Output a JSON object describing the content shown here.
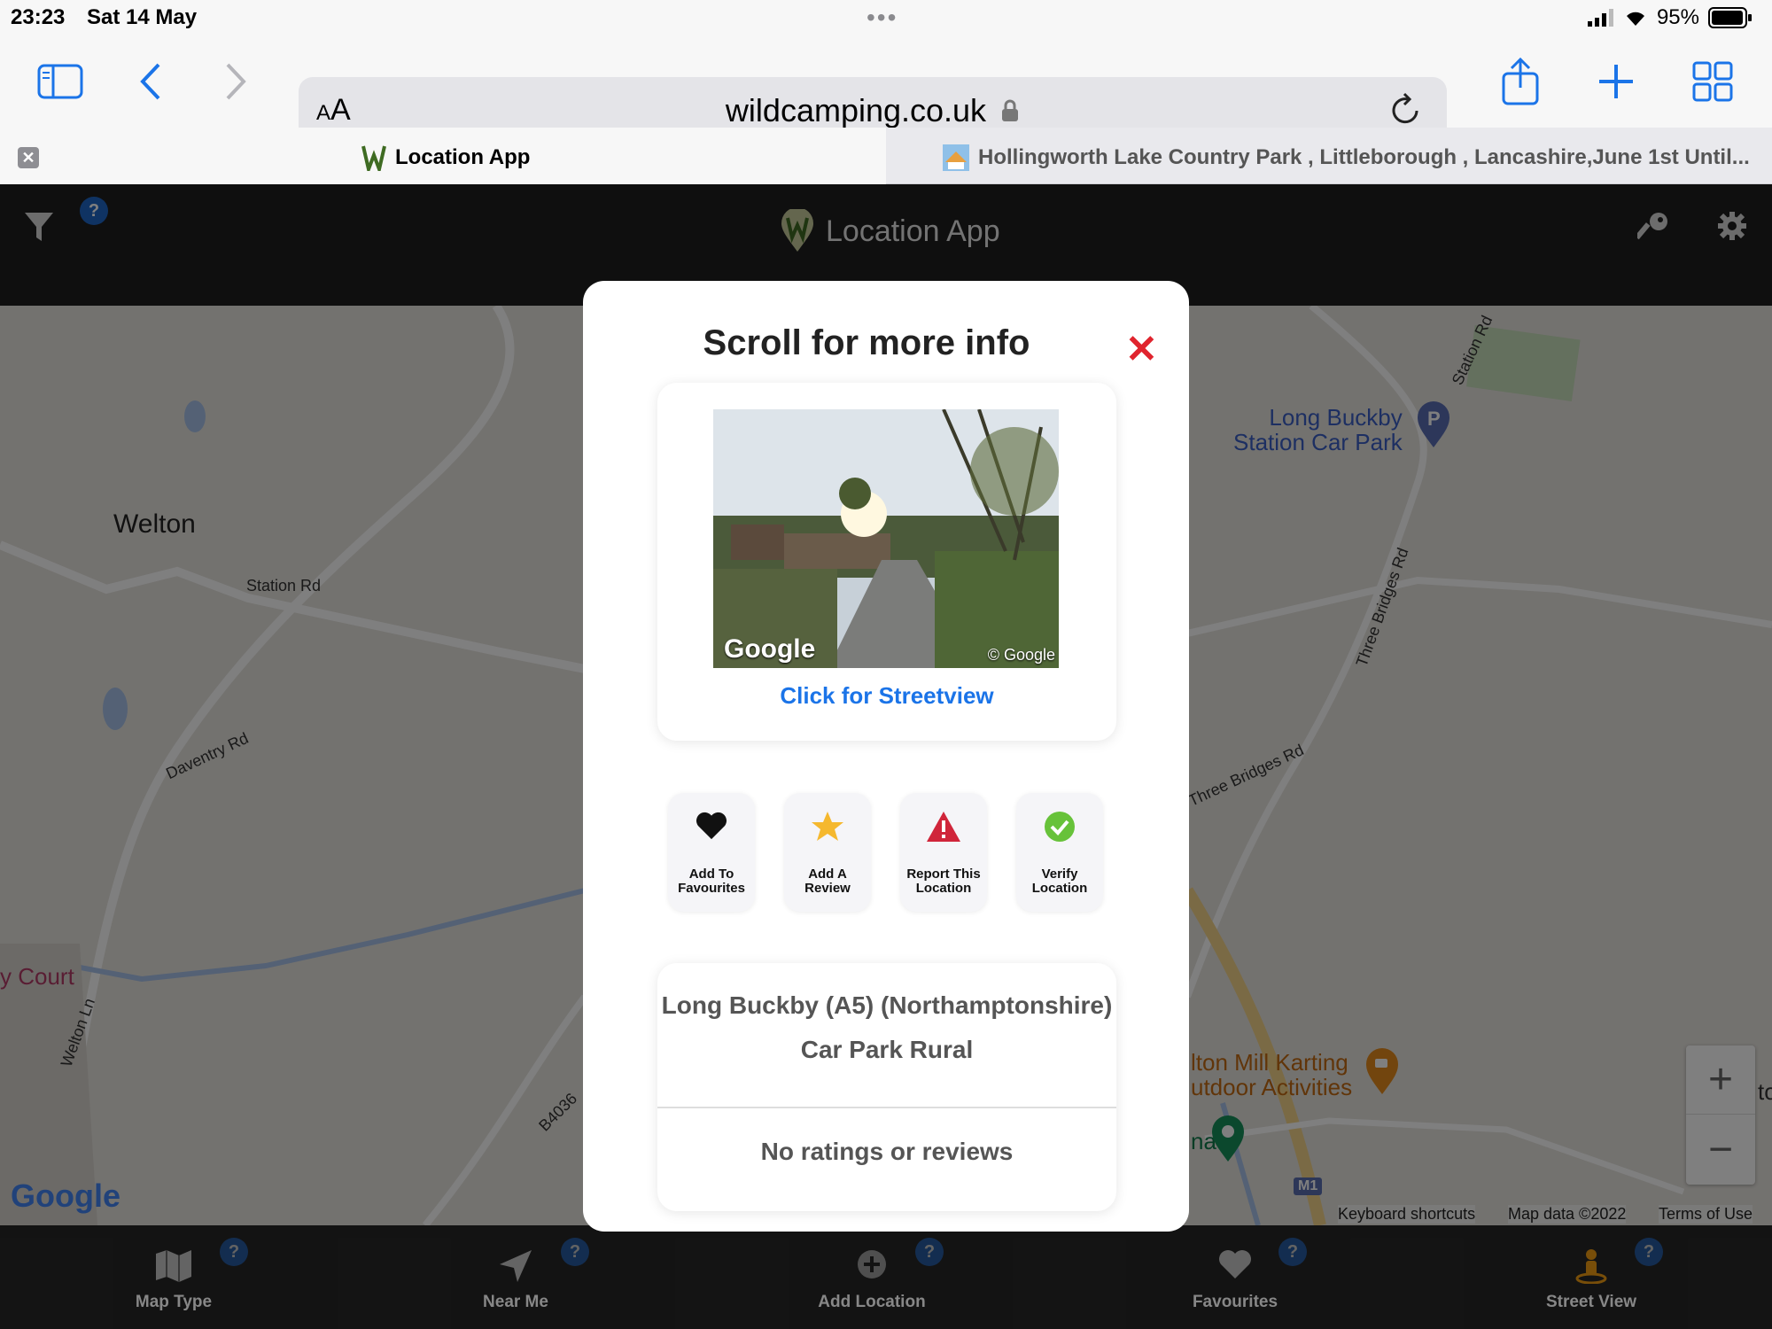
{
  "status_bar": {
    "time": "23:23",
    "date": "Sat 14 May",
    "battery": "95%"
  },
  "browser": {
    "url": "wildcamping.co.uk",
    "text_size_label_small": "A",
    "text_size_label_large": "A",
    "tabs": [
      {
        "label": "Location App"
      },
      {
        "label": "Hollingworth Lake Country Park , Littleborough , Lancashire,June 1st Until..."
      }
    ]
  },
  "app_header": {
    "title": "Location App",
    "help_badge": "?"
  },
  "map": {
    "labels": {
      "welton": "Welton",
      "station_rd_left": "Station Rd",
      "daventry_rd": "Daventry Rd",
      "court": "y Court",
      "welton_ln": "Welton Ln",
      "b4036": "B4036",
      "car_park_line1": "Long Buckby",
      "car_park_line2": "Station Car Park",
      "station_rd_right": "Station Rd",
      "three_bridges_rd_1": "Three Bridges Rd",
      "three_bridges_rd_2": "Three Bridges Rd",
      "karting_line1": "lton Mill Karting",
      "karting_line2": "utdoor Activities",
      "marina_frag": "na",
      "edge_frag": "to",
      "m1": "M1"
    },
    "attribution": {
      "shortcuts": "Keyboard shortcuts",
      "data": "Map data ©2022",
      "terms": "Terms of Use",
      "logo": "Google"
    },
    "zoom": {
      "in": "+",
      "out": "−"
    }
  },
  "modal": {
    "title": "Scroll for more info",
    "close": "✕",
    "photo_watermark_left": "Google",
    "photo_watermark_right": "© Google",
    "streetview_link": "Click for Streetview",
    "actions": [
      {
        "line1": "Add To",
        "line2": "Favourites"
      },
      {
        "line1": "Add A",
        "line2": "Review"
      },
      {
        "line1": "Report This",
        "line2": "Location"
      },
      {
        "line1": "Verify",
        "line2": "Location"
      }
    ],
    "location_name": "Long Buckby (A5) (Northamptonshire)",
    "location_type": "Car Park Rural",
    "reviews": "No ratings or reviews"
  },
  "bottom_nav": [
    {
      "label": "Map Type",
      "badge": "?"
    },
    {
      "label": "Near Me",
      "badge": "?"
    },
    {
      "label": "Add Location",
      "badge": "?"
    },
    {
      "label": "Favourites",
      "badge": "?"
    },
    {
      "label": "Street View",
      "badge": "?"
    }
  ],
  "colors": {
    "accent_blue": "#1b74e8",
    "close_red": "#e0242e",
    "header_dark": "#1e1e1e",
    "badge_blue": "#1f67c7",
    "street_view_orange": "#f0a020"
  }
}
